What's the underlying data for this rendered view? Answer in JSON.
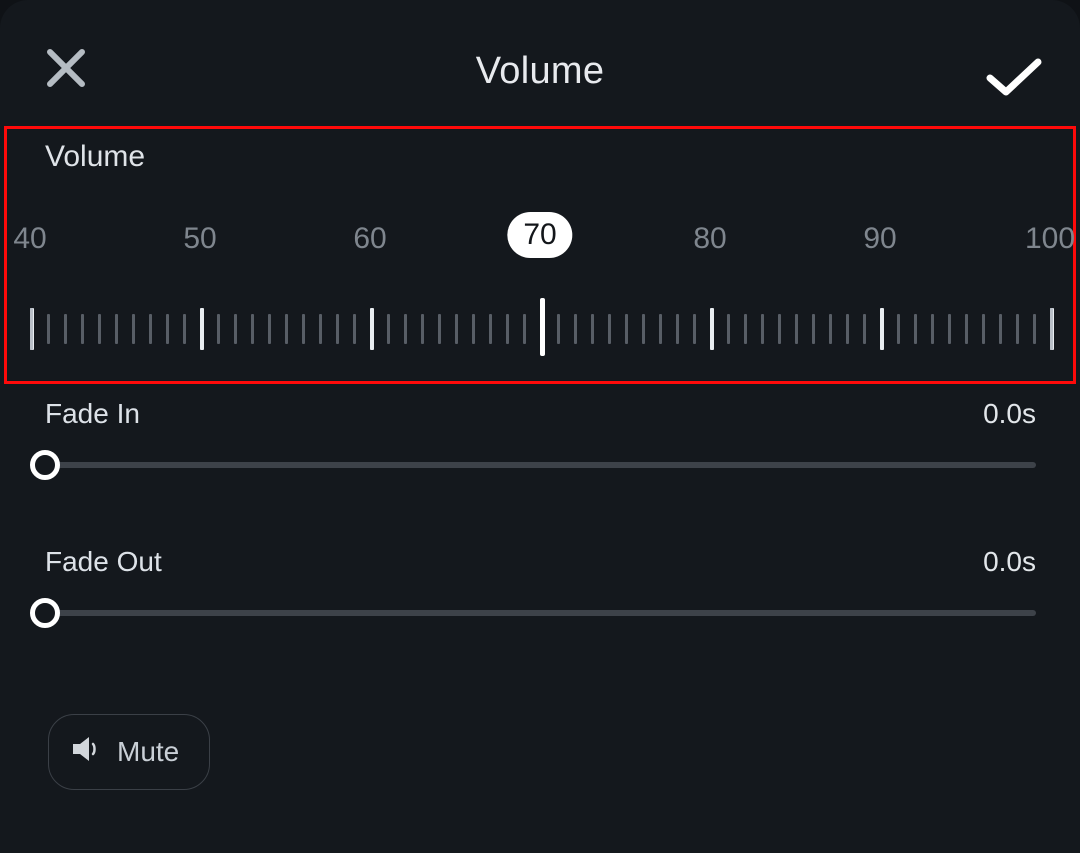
{
  "header": {
    "title": "Volume"
  },
  "volume": {
    "label": "Volume",
    "current": 70,
    "tick_labels": [
      40,
      50,
      60,
      70,
      80,
      90,
      100
    ]
  },
  "fade_in": {
    "label": "Fade In",
    "value_text": "0.0s",
    "value": 0
  },
  "fade_out": {
    "label": "Fade Out",
    "value_text": "0.0s",
    "value": 0
  },
  "mute": {
    "label": "Mute"
  },
  "icons": {
    "close": "close-icon",
    "confirm": "check-icon",
    "speaker": "speaker-icon"
  }
}
